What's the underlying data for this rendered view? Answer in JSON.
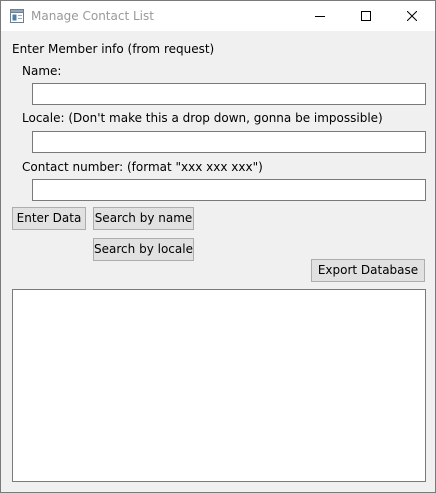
{
  "window": {
    "title": "Manage Contact List",
    "icon": "app-window-icon"
  },
  "form": {
    "heading": "Enter Member info (from request)",
    "name_label": "Name:",
    "name_value": "",
    "locale_label": "Locale: (Don't make this a drop down, gonna be impossible)",
    "locale_value": "",
    "contact_label": "Contact number: (format \"xxx xxx xxx\")",
    "contact_value": ""
  },
  "buttons": {
    "enter_data": "Enter Data",
    "search_by_name": "Search by name",
    "search_by_locale": "Search by locale",
    "export_database": "Export Database"
  },
  "output": {
    "text": ""
  }
}
